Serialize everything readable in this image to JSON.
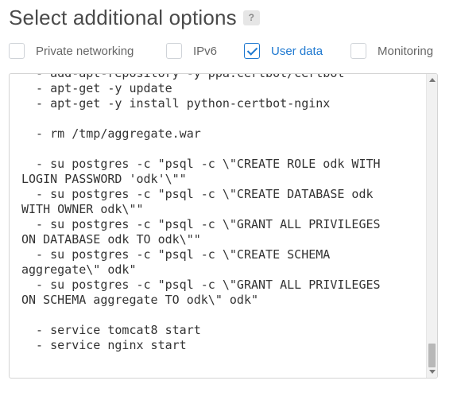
{
  "header": {
    "title": "Select additional options",
    "help_label": "?"
  },
  "options": [
    {
      "label": "Private networking",
      "checked": false
    },
    {
      "label": "IPv6",
      "checked": false
    },
    {
      "label": "User data",
      "checked": true
    },
    {
      "label": "Monitoring",
      "checked": false
    }
  ],
  "user_data": {
    "text": "  - add-apt-repository -y ppa:certbot/certbot\n  - apt-get -y update\n  - apt-get -y install python-certbot-nginx\n\n  - rm /tmp/aggregate.war\n\n  - su postgres -c \"psql -c \\\"CREATE ROLE odk WITH\nLOGIN PASSWORD 'odk'\\\"\"\n  - su postgres -c \"psql -c \\\"CREATE DATABASE odk\nWITH OWNER odk\\\"\"\n  - su postgres -c \"psql -c \\\"GRANT ALL PRIVILEGES\nON DATABASE odk TO odk\\\"\"\n  - su postgres -c \"psql -c \\\"CREATE SCHEMA\naggregate\\\" odk\"\n  - su postgres -c \"psql -c \\\"GRANT ALL PRIVILEGES\nON SCHEMA aggregate TO odk\\\" odk\"\n\n  - service tomcat8 start\n  - service nginx start"
  },
  "colors": {
    "accent": "#1d78d0",
    "checkbox_border": "#cfd3d8"
  },
  "icons": {
    "help": "question-mark-icon",
    "check": "checkmark-icon"
  }
}
